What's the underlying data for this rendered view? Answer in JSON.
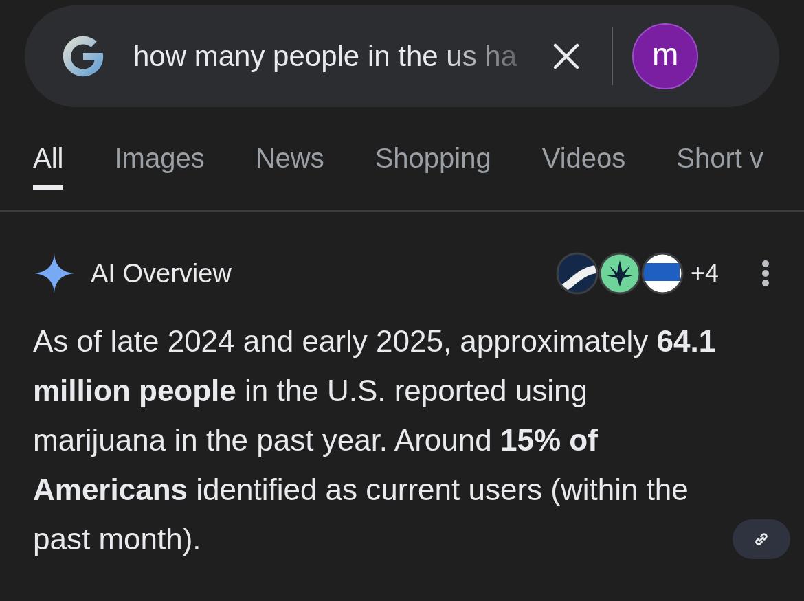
{
  "search": {
    "query": "how many people in the us ha",
    "avatar": "m"
  },
  "tabs": [
    {
      "label": "All",
      "selected": true
    },
    {
      "label": "Images",
      "selected": false
    },
    {
      "label": "News",
      "selected": false
    },
    {
      "label": "Shopping",
      "selected": false
    },
    {
      "label": "Videos",
      "selected": false
    },
    {
      "label": "Short v",
      "selected": false
    }
  ],
  "ai_overview": {
    "title": "AI Overview",
    "sources_more": "+4",
    "text": "As of late 2024 and early 2025, approximately **64.1 million people** in the U.S. reported using marijuana in the past year. Around **15% of Americans** identified as current users (within the past month)."
  }
}
